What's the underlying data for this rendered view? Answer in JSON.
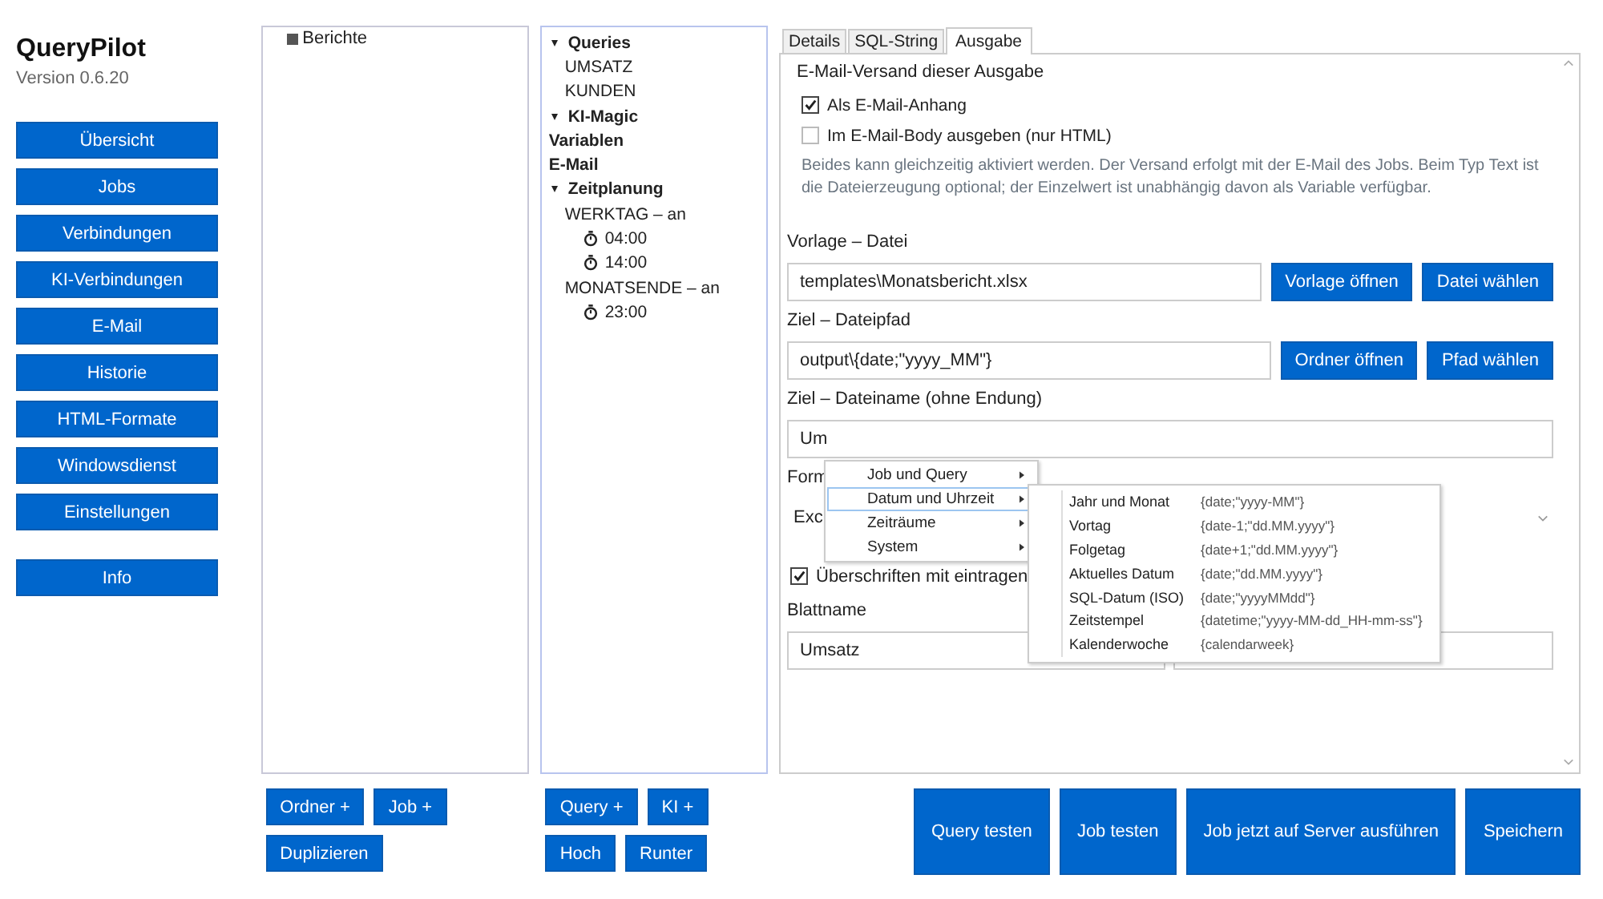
{
  "app": {
    "title": "QueryPilot",
    "version": "Version 0.6.20"
  },
  "nav": [
    {
      "label": "Übersicht"
    },
    {
      "label": "Jobs"
    },
    {
      "label": "Verbindungen"
    },
    {
      "label": "KI-Verbindungen"
    },
    {
      "label": "E-Mail"
    },
    {
      "label": "Historie"
    },
    {
      "label": "HTML-Formate"
    },
    {
      "label": "Windowsdienst"
    },
    {
      "label": "Einstellungen"
    }
  ],
  "info_button": "Info",
  "folder_tree": [
    {
      "label": "Berichte"
    }
  ],
  "job_tree": [
    {
      "label": "Queries",
      "kind": "group",
      "expanded": true,
      "children": [
        {
          "label": "UMSATZ",
          "kind": "item"
        },
        {
          "label": "KUNDEN",
          "kind": "item"
        }
      ]
    },
    {
      "label": "KI-Magic",
      "kind": "group",
      "expanded": true
    },
    {
      "label": "Variablen",
      "kind": "header"
    },
    {
      "label": "E-Mail",
      "kind": "header"
    },
    {
      "label": "Zeitplanung",
      "kind": "group",
      "expanded": true,
      "children": [
        {
          "label": "WERKTAG – an",
          "kind": "item",
          "children": [
            {
              "label": "04:00",
              "kind": "time"
            },
            {
              "label": "14:00",
              "kind": "time"
            }
          ]
        },
        {
          "label": "MONATSENDE – an",
          "kind": "item",
          "children": [
            {
              "label": "23:00",
              "kind": "time"
            }
          ]
        }
      ]
    }
  ],
  "folder_buttons": [
    [
      "Ordner +",
      "Job +"
    ],
    [
      "Duplizieren"
    ]
  ],
  "job_buttons": [
    [
      "Query +",
      "KI +"
    ],
    [
      "Hoch",
      "Runter"
    ]
  ],
  "tabs": [
    {
      "label": "Details",
      "selected": false
    },
    {
      "label": "SQL-String",
      "selected": false
    },
    {
      "label": "Ausgabe",
      "selected": true
    }
  ],
  "output": {
    "email_heading": "E-Mail-Versand dieser Ausgabe",
    "email_options": [
      {
        "label": "Als E-Mail-Anhang",
        "checked": true
      },
      {
        "label": "Im E-Mail-Body ausgeben (nur HTML)",
        "checked": false
      }
    ],
    "hint": "Beides kann gleichzeitig aktiviert werden. Der Versand erfolgt mit der E-Mail des Jobs. Beim Typ Text ist die Dateierzeugung optional; der Einzelwert ist unabhängig davon als Variable verfügbar.",
    "template_label": "Vorlage – Datei",
    "template_value": "templates\\Monatsbericht.xlsx",
    "template_buttons": [
      "Vorlage öffnen",
      "Datei wählen"
    ],
    "path_label": "Ziel – Dateipfad",
    "path_value": "output\\{date;\"yyyy_MM\"}",
    "path_buttons": [
      "Ordner öffnen",
      "Pfad wählen"
    ],
    "filename_label": "Ziel – Dateiname (ohne Endung)",
    "filename_value": "Um",
    "format_label": "Form",
    "format_value": "Exc",
    "headers_checkbox": {
      "label": "Überschriften mit eintragen",
      "checked": true
    },
    "sheet_label": "Blattname",
    "sheet_value": "Umsatz"
  },
  "context_menu": {
    "items": [
      {
        "label": "Job und Query",
        "selected": false
      },
      {
        "label": "Datum und Uhrzeit",
        "selected": true
      },
      {
        "label": "Zeiträume",
        "selected": false
      },
      {
        "label": "System",
        "selected": false
      }
    ],
    "submenu": [
      {
        "label": "Jahr und Monat",
        "value": "{date;\"yyyy-MM\"}"
      },
      {
        "label": "Vortag",
        "value": "{date-1;\"dd.MM.yyyy\"}"
      },
      {
        "label": "Folgetag",
        "value": "{date+1;\"dd.MM.yyyy\"}"
      },
      {
        "label": "Aktuelles Datum",
        "value": "{date;\"dd.MM.yyyy\"}"
      },
      {
        "label": "SQL-Datum (ISO)",
        "value": "{date;\"yyyyMMdd\"}"
      },
      {
        "label": "Zeitstempel",
        "value": "{datetime;\"yyyy-MM-dd_HH-mm-ss\"}"
      },
      {
        "label": "Kalenderwoche",
        "value": "{calendarweek}"
      }
    ]
  },
  "actions": [
    "Query testen",
    "Job testen",
    "Job jetzt auf Server ausführen",
    "Speichern"
  ]
}
